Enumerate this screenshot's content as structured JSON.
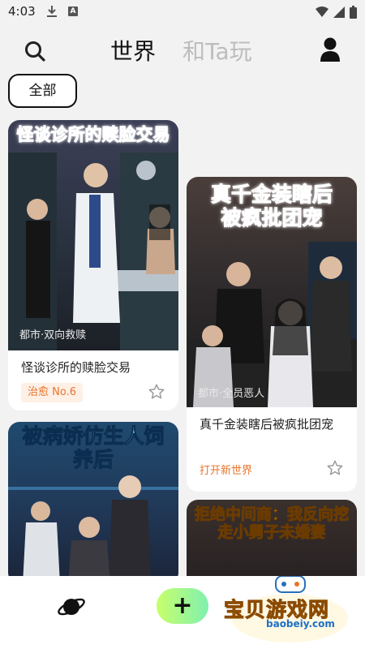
{
  "status_bar": {
    "time": "4:03",
    "notif_icon_a": "A"
  },
  "header": {
    "tabs": [
      "世界",
      "和Ta玩"
    ],
    "active_tab": "世界"
  },
  "filter": {
    "chip_label": "全部"
  },
  "cards": [
    {
      "cover_title": "怪谈诊所的赎脸交易",
      "cover_tag": "都市·双向救赎",
      "title": "怪谈诊所的赎脸交易",
      "badge": "治愈 No.6"
    },
    {
      "cover_title": "真千金装瞎后被疯批团宠",
      "cover_tag": "都市·全员恶人",
      "title": "真千金装瞎后被疯批团宠",
      "foot_label": "打开新世界"
    },
    {
      "cover_title": "被病娇仿生人饲养后"
    },
    {
      "cover_title": "拒绝中间商：我反向挖走小舅子未婚妻"
    }
  ],
  "bottom_bar": {
    "add_label": "+"
  },
  "watermark": {
    "main": "宝贝游戏网",
    "url": "baobeiy.com"
  },
  "colors": {
    "accent_orange": "#e8742a",
    "cover_title_pink": "#ff5a6e"
  }
}
